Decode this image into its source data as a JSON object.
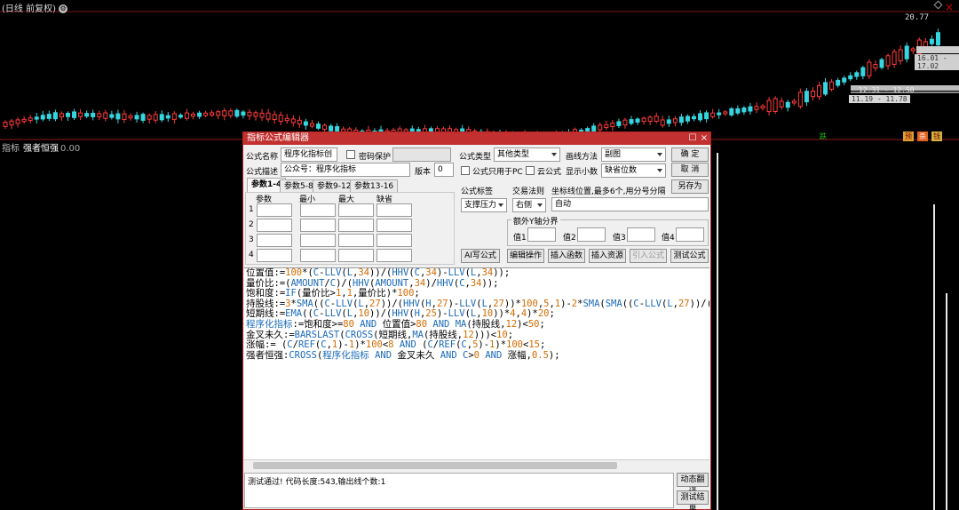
{
  "chart": {
    "header": "(日线 前复权)",
    "price_high": "20.77",
    "range_label_1": "16.01 - 17.02",
    "range_label_2": "12.31 - 12.50",
    "range_label_3": "11.19 - 11.78",
    "signals": [
      "跌",
      "预",
      "杀",
      "钱"
    ],
    "indicator_name": "指标",
    "indicator_sub": "强者恒强",
    "indicator_value": "0.00"
  },
  "dialog": {
    "title": "指标公式编辑器",
    "formula_name_label": "公式名称",
    "formula_name_value": "程序化指标创",
    "password_label": "密码保护",
    "formula_desc_label": "公式描述",
    "formula_desc_value": "公众号：程序化指标",
    "version_label": "版本",
    "version_value": "0",
    "formula_type_label": "公式类型",
    "formula_type_value": "其他类型",
    "draw_method_label": "画线方法",
    "draw_method_value": "副图",
    "ok_label": "确 定",
    "cancel_label": "取 消",
    "save_as_label": "另存为",
    "pc_only_label": "公式只用于PC",
    "cloud_label": "云公式",
    "decimals_label": "显示小数",
    "decimals_value": "缺省位数",
    "tabs": [
      "参数1-4",
      "参数5-8",
      "参数9-12",
      "参数13-16"
    ],
    "param_headers": [
      "参数",
      "最小",
      "最大",
      "缺省"
    ],
    "param_rows": [
      "1",
      "2",
      "3",
      "4"
    ],
    "formula_tag_label": "公式标签",
    "formula_tag_value": "支撑压力",
    "trade_rule_label": "交易法则",
    "trade_rule_value": "右侧",
    "coord_label": "坐标线位置,最多6个,用分号分隔",
    "coord_value": "自动",
    "extra_y_label": "额外Y轴分界",
    "val_labels": [
      "值1",
      "值2",
      "值3",
      "值4"
    ],
    "buttons": {
      "ai": "AI写公式",
      "edit_op": "编辑操作",
      "insert_func": "插入函数",
      "insert_res": "插入资源",
      "import": "引入公式",
      "test": "测试公式"
    },
    "status_text": "测试通过! 代码长度:543,输出线个数:1",
    "dyn_translate": "动态翻译",
    "test_result": "测试结果"
  }
}
